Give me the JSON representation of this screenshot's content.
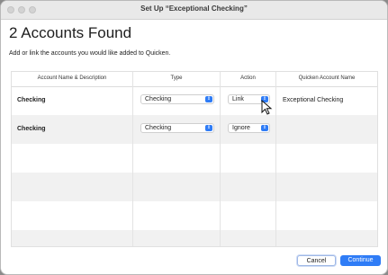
{
  "window": {
    "title": "Set Up “Exceptional Checking”"
  },
  "header": {
    "heading": "2 Accounts Found",
    "subtext": "Add or link the accounts you would like added to Quicken."
  },
  "table": {
    "columns": [
      "Account Name & Description",
      "Type",
      "Action",
      "Quicken Account Name"
    ],
    "rows": [
      {
        "name": "Checking",
        "type": "Checking",
        "action": "Link",
        "quicken_name": "Exceptional Checking"
      },
      {
        "name": "Checking",
        "type": "Checking",
        "action": "Ignore",
        "quicken_name": ""
      }
    ]
  },
  "footer": {
    "cancel_label": "Cancel",
    "continue_label": "Continue"
  },
  "colors": {
    "accent": "#2f7cf6",
    "row_alt": "#f1f1f1"
  }
}
